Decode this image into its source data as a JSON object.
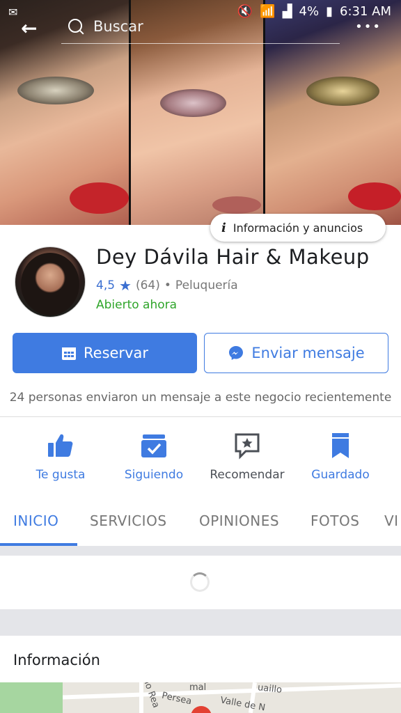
{
  "status_bar": {
    "battery": "4%",
    "time": "6:31 AM"
  },
  "search": {
    "placeholder": "Buscar"
  },
  "info_chip": {
    "icon": "i",
    "label": "Información y anuncios"
  },
  "page": {
    "name": "Dey Dávila Hair & Makeup",
    "rating": "4,5",
    "reviews": "(64)",
    "separator": "•",
    "category": "Peluquería",
    "status": "Abierto ahora"
  },
  "buttons": {
    "book": "Reservar",
    "message": "Enviar mensaje"
  },
  "notice": "24 personas enviaron un mensaje a este negocio recientemente",
  "actions": [
    {
      "label": "Te gusta",
      "icon": "thumbs-up-icon"
    },
    {
      "label": "Siguiendo",
      "icon": "following-check-icon"
    },
    {
      "label": "Recomendar",
      "icon": "recommend-star-icon"
    },
    {
      "label": "Guardado",
      "icon": "bookmark-icon"
    }
  ],
  "tabs": [
    "INICIO",
    "SERVICIOS",
    "OPINIONES",
    "FOTOS",
    "VI"
  ],
  "section": {
    "title": "Información"
  },
  "map": {
    "labels": [
      "Persea",
      "Valle de N",
      "uaillo",
      "ino Rea",
      "mal"
    ]
  },
  "colors": {
    "accent": "#3f7be1",
    "open": "#2fa52a"
  }
}
